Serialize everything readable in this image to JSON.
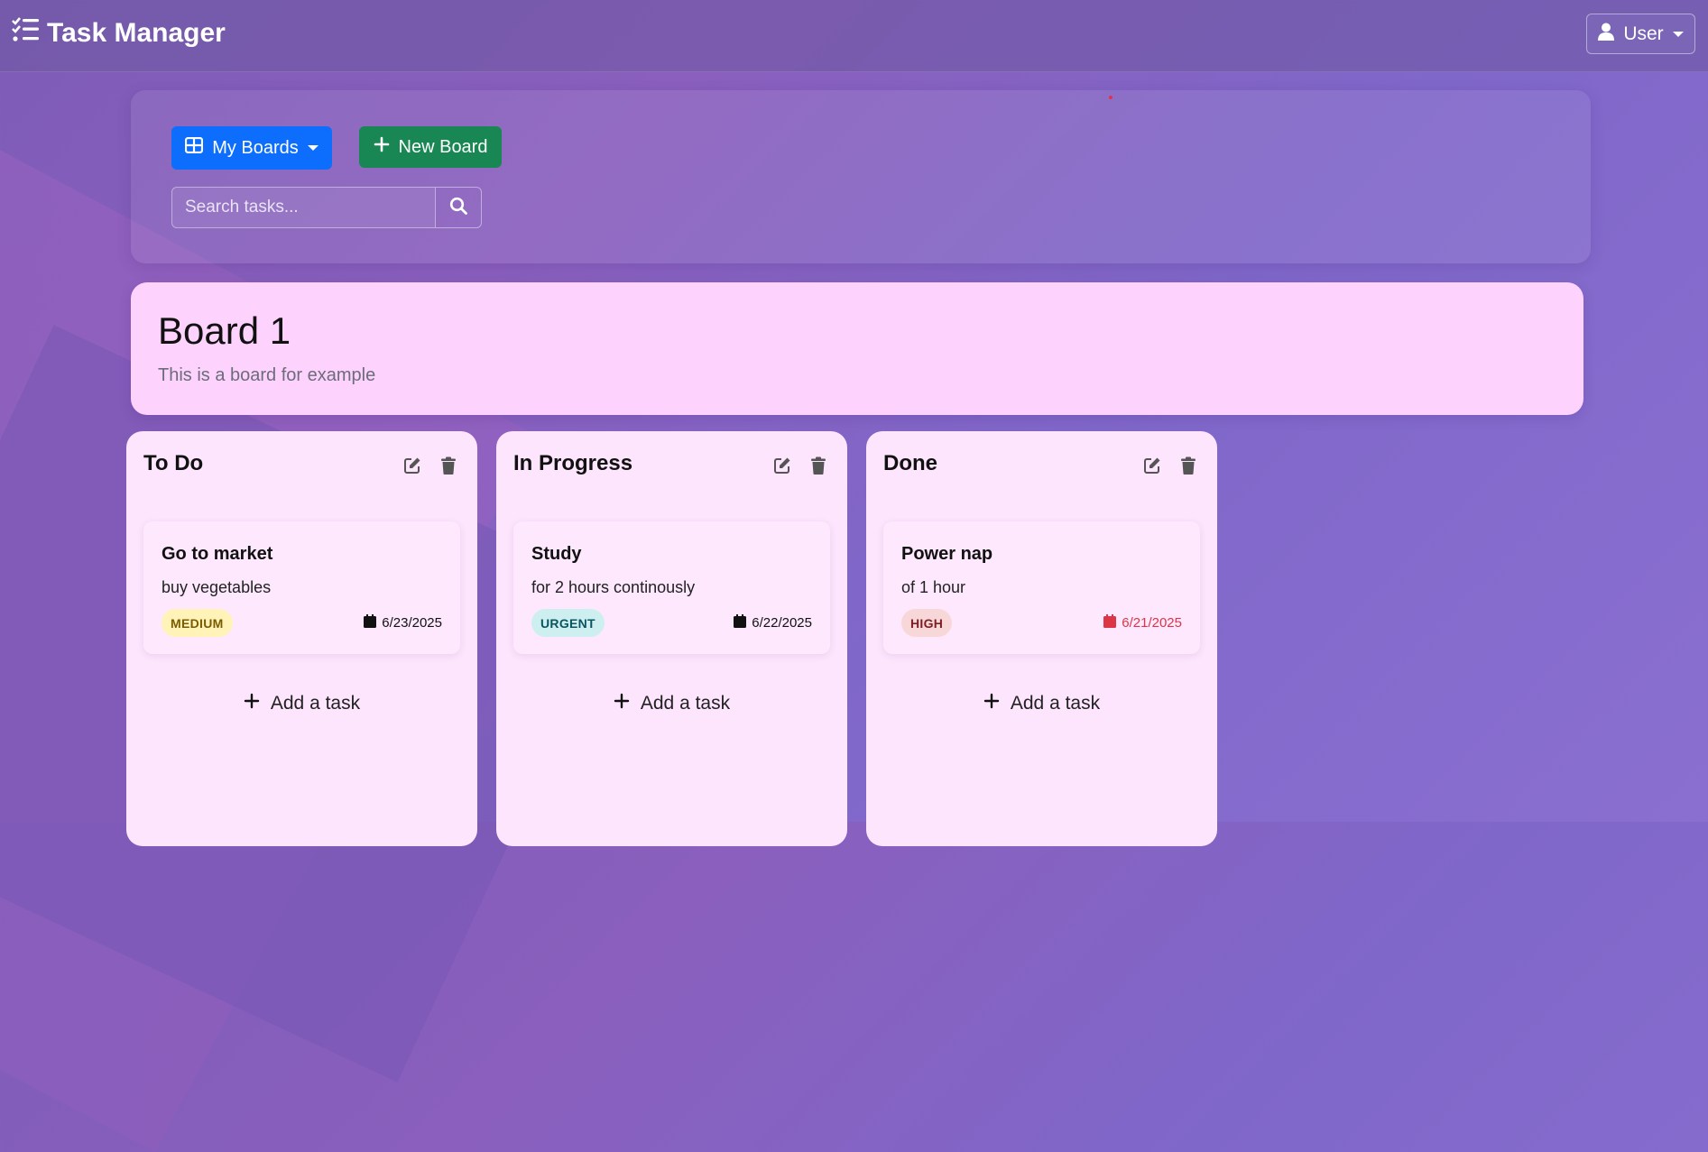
{
  "app": {
    "title": "Task Manager",
    "user_label": "User"
  },
  "toolbar": {
    "boards_label": "My Boards",
    "new_board_label": "New Board",
    "search_placeholder": "Search tasks..."
  },
  "board": {
    "title": "Board 1",
    "description": "This is a board for example"
  },
  "columns": [
    {
      "title": "To Do",
      "task": {
        "title": "Go to market",
        "description": "buy vegetables",
        "priority": "MEDIUM",
        "due": "6/23/2025"
      },
      "add_label": "Add a task"
    },
    {
      "title": "In Progress",
      "task": {
        "title": "Study",
        "description": "for 2 hours continously",
        "priority": "URGENT",
        "due": "6/22/2025"
      },
      "add_label": "Add a task"
    },
    {
      "title": "Done",
      "task": {
        "title": "Power nap",
        "description": "of 1 hour",
        "priority": "HIGH",
        "due": "6/21/2025"
      },
      "add_label": "Add a task"
    }
  ],
  "colors": {
    "primary": "#0d6efd",
    "success": "#198754",
    "medium_badge_bg": "#fff3b8",
    "urgent_badge_bg": "#cdeff0",
    "high_badge_bg": "#f8d7d9",
    "overdue": "#dc3545"
  }
}
